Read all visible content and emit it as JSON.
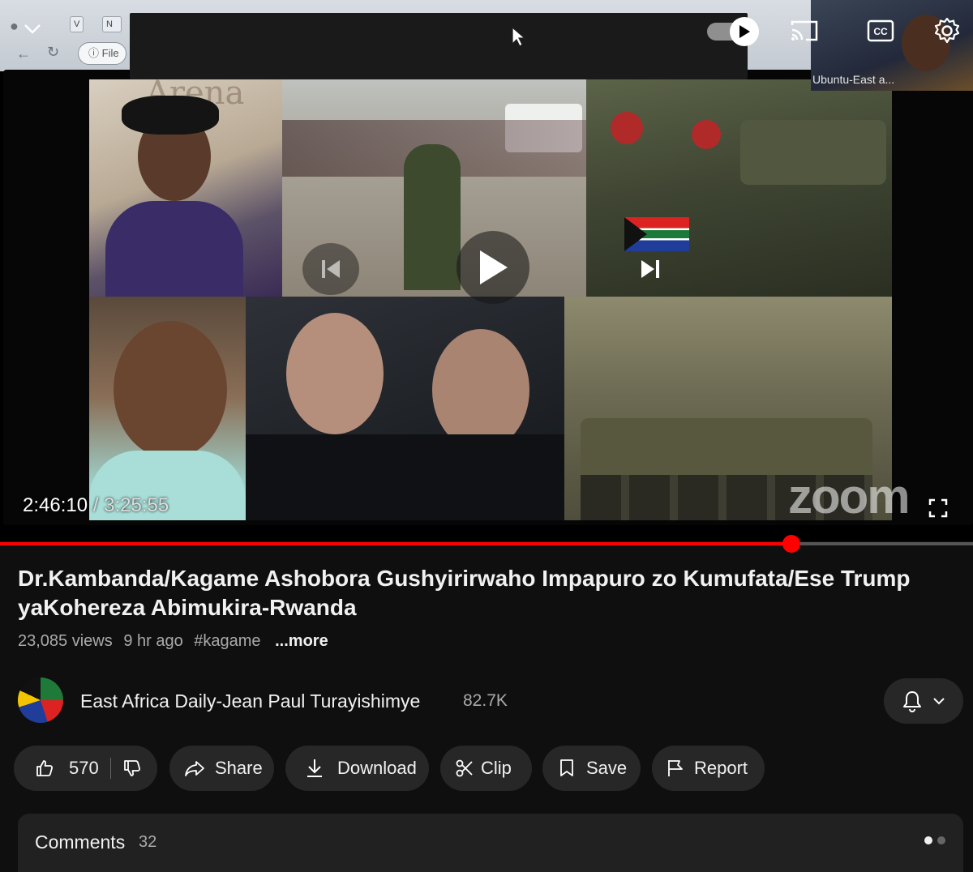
{
  "player": {
    "current_time": "2:46:10",
    "separator": " / ",
    "duration": "3:25:55",
    "progress_fraction": 0.813,
    "autoplay_on": true,
    "watermark": "zoom",
    "pip_label": "Ubuntu-East a...",
    "browser": {
      "file_label": "File",
      "tab_letters": [
        "V",
        "N"
      ]
    },
    "collage_text": "Arena"
  },
  "video": {
    "title": "Dr.Kambanda/Kagame Ashobora Gushyirirwaho Impapuro zo Kumufata/Ese Trump yaKohereza Abimukira-Rwanda",
    "views": "23,085 views",
    "age": "9 hr ago",
    "hashtag": "#kagame",
    "more_label": "...more"
  },
  "channel": {
    "name": "East Africa Daily-Jean Paul Turayishimye",
    "subscribers": "82.7K"
  },
  "actions": {
    "likes": "570",
    "share": "Share",
    "download": "Download",
    "clip": "Clip",
    "save": "Save",
    "report": "Report"
  },
  "comments": {
    "title": "Comments",
    "count": "32"
  },
  "colors": {
    "accent": "#ff0000",
    "background": "#0f0f0f",
    "pill": "#272727"
  }
}
